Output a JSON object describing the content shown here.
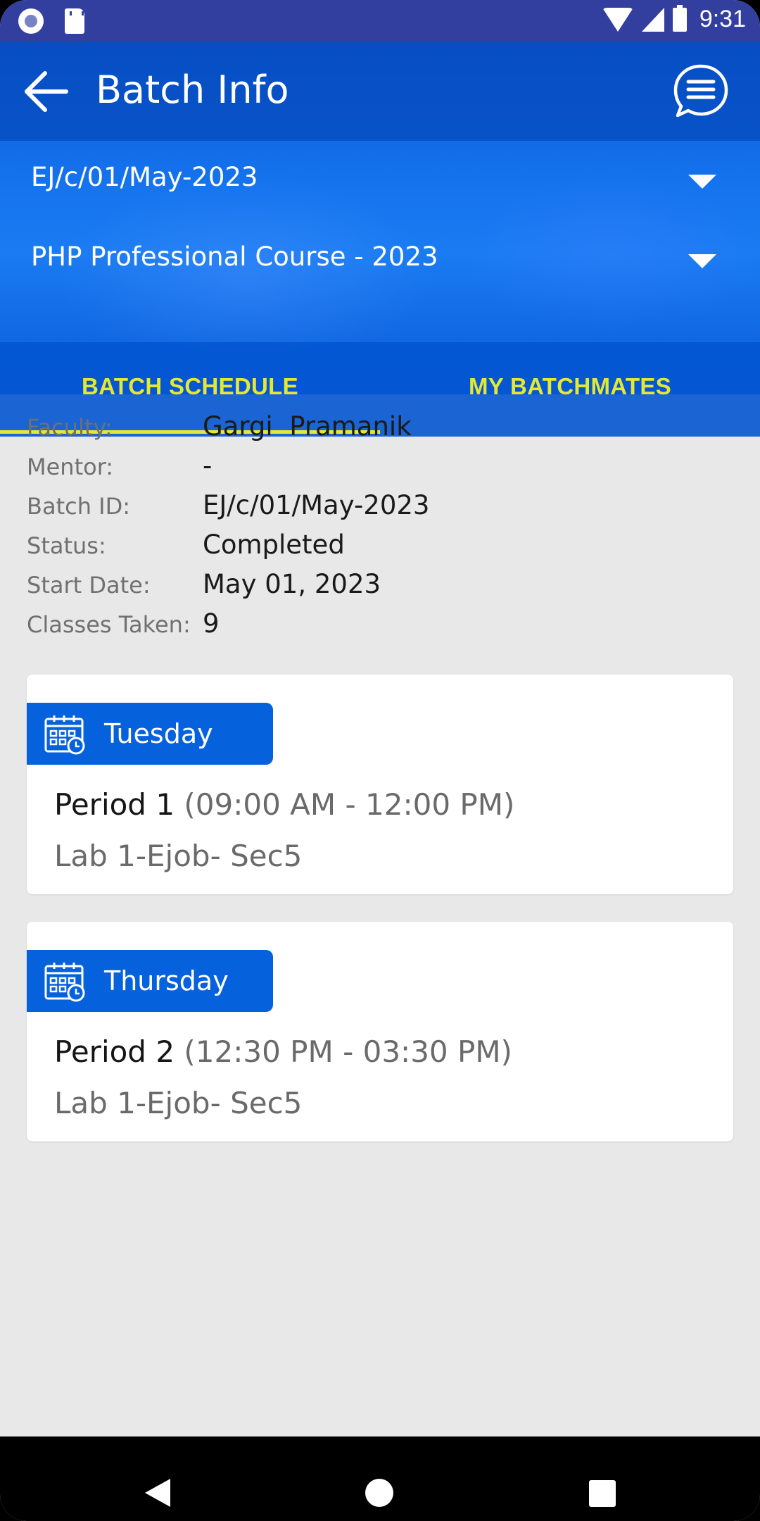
{
  "status_bar": {
    "time": "9:31",
    "left_icons": [
      "notification-circle-icon",
      "sd-card-icon"
    ],
    "right_icons": [
      "wifi-icon",
      "signal-icon",
      "battery-icon"
    ]
  },
  "app_bar": {
    "title": "Batch Info",
    "back_icon": "arrow-left-icon",
    "action_icon": "chat-menu-icon"
  },
  "selectors": {
    "batch": {
      "value": "EJ/c/01/May-2023"
    },
    "course": {
      "value": "PHP Professional Course - 2023"
    }
  },
  "tabs": [
    {
      "label": "BATCH SCHEDULE",
      "active": true
    },
    {
      "label": "MY BATCHMATES",
      "active": false
    }
  ],
  "details": [
    {
      "label": "Faculty:",
      "value": "Gargi  Pramanik"
    },
    {
      "label": "Mentor:",
      "value": "-"
    },
    {
      "label": "Batch ID:",
      "value": "EJ/c/01/May-2023"
    },
    {
      "label": "Status:",
      "value": "Completed"
    },
    {
      "label": "Start Date:",
      "value": "May 01, 2023"
    },
    {
      "label": "Classes Taken:",
      "value": "9"
    }
  ],
  "schedule": [
    {
      "day": "Tuesday",
      "period": "Period 1",
      "time": "(09:00 AM - 12:00 PM)",
      "room": "Lab 1-Ejob- Sec5"
    },
    {
      "day": "Thursday",
      "period": "Period 2",
      "time": "(12:30 PM - 03:30 PM)",
      "room": "Lab 1-Ejob- Sec5"
    }
  ],
  "colors": {
    "status_bar": "#333f9e",
    "primary": "#0561dc",
    "tab_text": "#e4e833",
    "background": "#e8e8e8"
  }
}
